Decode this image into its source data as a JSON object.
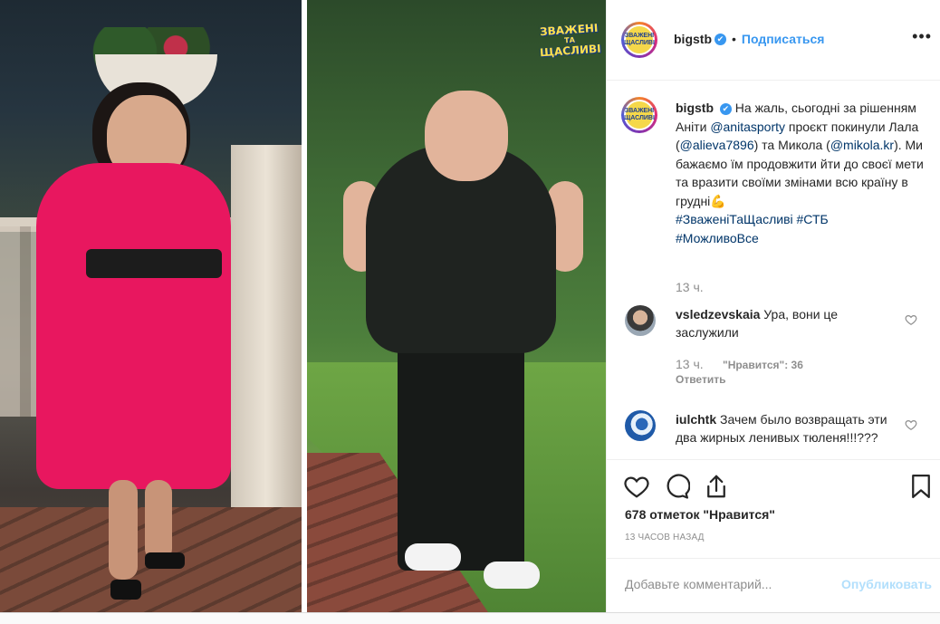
{
  "post": {
    "username": "bigstb",
    "verified_mark": "✔",
    "separator": "•",
    "follow_label": "Подписаться",
    "more_label": "•••",
    "avatar_text": "ЗВАЖЕНІ ЩАСЛИВІ",
    "show_logo": [
      "ЗВАЖЕНІ",
      "ТА",
      "ЩАСЛИВІ"
    ]
  },
  "caption": {
    "username": "bigstb",
    "text_1": "На жаль, сьогодні за рішенням Аніти ",
    "mention_1": "@anitasporty",
    "text_2": " проєкт покинули Лала (",
    "mention_2": "@alieva7896",
    "text_3": ") та Микола (",
    "mention_3": "@mikola.kr",
    "text_4": "). Ми бажаємо їм продовжити йти до своєї мети та вразити своїми змінами всю країну в грудні💪",
    "hashtag_1": "#ЗваженіТаЩасливі",
    "hashtag_2": "#СТБ",
    "hashtag_3": "#МожливоВсе",
    "time": "13 ч."
  },
  "comments": [
    {
      "username": "vsledzevskaia",
      "text": "Ура, вони це заслужили",
      "time": "13 ч.",
      "likes": "\"Нравится\": 36",
      "reply": "Ответить"
    },
    {
      "username": "iulchtk",
      "text": "Зачем было возвращать эти два жирных ленивых тюленя!!!???"
    }
  ],
  "actions": {
    "likes_count": "678 отметок \"Нравится\"",
    "time_ago": "13 ЧАСОВ НАЗАД"
  },
  "add_comment": {
    "placeholder": "Добавьте комментарий...",
    "publish_label": "Опубликовать"
  },
  "colors": {
    "link_blue": "#3897f0",
    "mention_navy": "#003569",
    "muted_gray": "#8e8e8e",
    "publish_disabled": "#b2dffc"
  },
  "icons": [
    "heart-icon",
    "comment-icon",
    "share-icon",
    "bookmark-icon",
    "more-icon",
    "verified-icon"
  ]
}
